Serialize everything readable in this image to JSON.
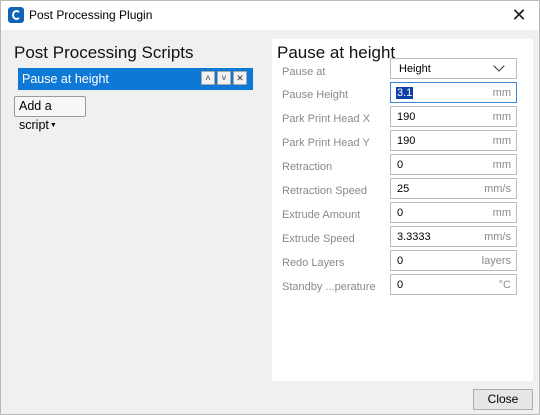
{
  "window": {
    "title": "Post Processing Plugin",
    "close_icon": "close-icon",
    "app_icon": "cura-icon"
  },
  "left": {
    "heading": "Post Processing Scripts",
    "scripts": [
      {
        "label": "Pause at height",
        "selected": true
      }
    ],
    "add_script_label": "Add a script"
  },
  "right": {
    "heading": "Pause at height",
    "settings": [
      {
        "label": "Pause at",
        "value": "Height",
        "unit": ""
      },
      {
        "label": "Pause Height",
        "value": "3.1",
        "unit": "mm"
      },
      {
        "label": "Park Print Head X",
        "value": "190",
        "unit": "mm"
      },
      {
        "label": "Park Print Head Y",
        "value": "190",
        "unit": "mm"
      },
      {
        "label": "Retraction",
        "value": "0",
        "unit": "mm"
      },
      {
        "label": "Retraction Speed",
        "value": "25",
        "unit": "mm/s"
      },
      {
        "label": "Extrude Amount",
        "value": "0",
        "unit": "mm"
      },
      {
        "label": "Extrude Speed",
        "value": "3.3333",
        "unit": "mm/s"
      },
      {
        "label": "Redo Layers",
        "value": "0",
        "unit": "layers"
      },
      {
        "label": "Standby ...perature",
        "value": "0",
        "unit": "°C"
      }
    ]
  },
  "footer": {
    "close_label": "Close"
  },
  "colors": {
    "accent": "#0e78d6",
    "selection": "#0e3fa8"
  }
}
